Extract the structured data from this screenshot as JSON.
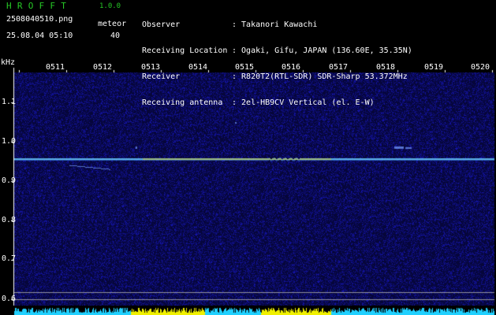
{
  "header": {
    "app_title": "H R O F F T",
    "app_version": "1.0.0",
    "file_name": "2508040510.png",
    "datetime": "25.08.04 05:10",
    "meteor_label": "meteor",
    "meteor_count": "40"
  },
  "station_info": [
    {
      "key": "Observer",
      "value": ": Takanori Kawachi"
    },
    {
      "key": "Receiving Location",
      "value": ": Ogaki, Gifu, JAPAN (136.60E, 35.35N)"
    },
    {
      "key": "Receiver",
      "value": ": R820T2(RTL-SDR) SDR-Sharp 53.372MHz"
    },
    {
      "key": "Receiving antenna",
      "value": ": 2el-HB9CV Vertical (el. E-W)"
    }
  ],
  "axes": {
    "frequency_unit": "kHz",
    "frequency_ticks": [
      "1.1",
      "1.0",
      "0.9",
      "0.8",
      "0.7",
      "0.6"
    ],
    "time_ticks": [
      "0511",
      "0512",
      "0513",
      "0514",
      "0515",
      "0516",
      "0517",
      "0518",
      "0519",
      "0520"
    ]
  },
  "colors": {
    "title_green": "#26c926",
    "background": "#000000",
    "noise": "#14148a",
    "carrier": "#c8ff5a",
    "bars_cyan": "#20d0ff",
    "bars_yellow": "#f0f000"
  }
}
